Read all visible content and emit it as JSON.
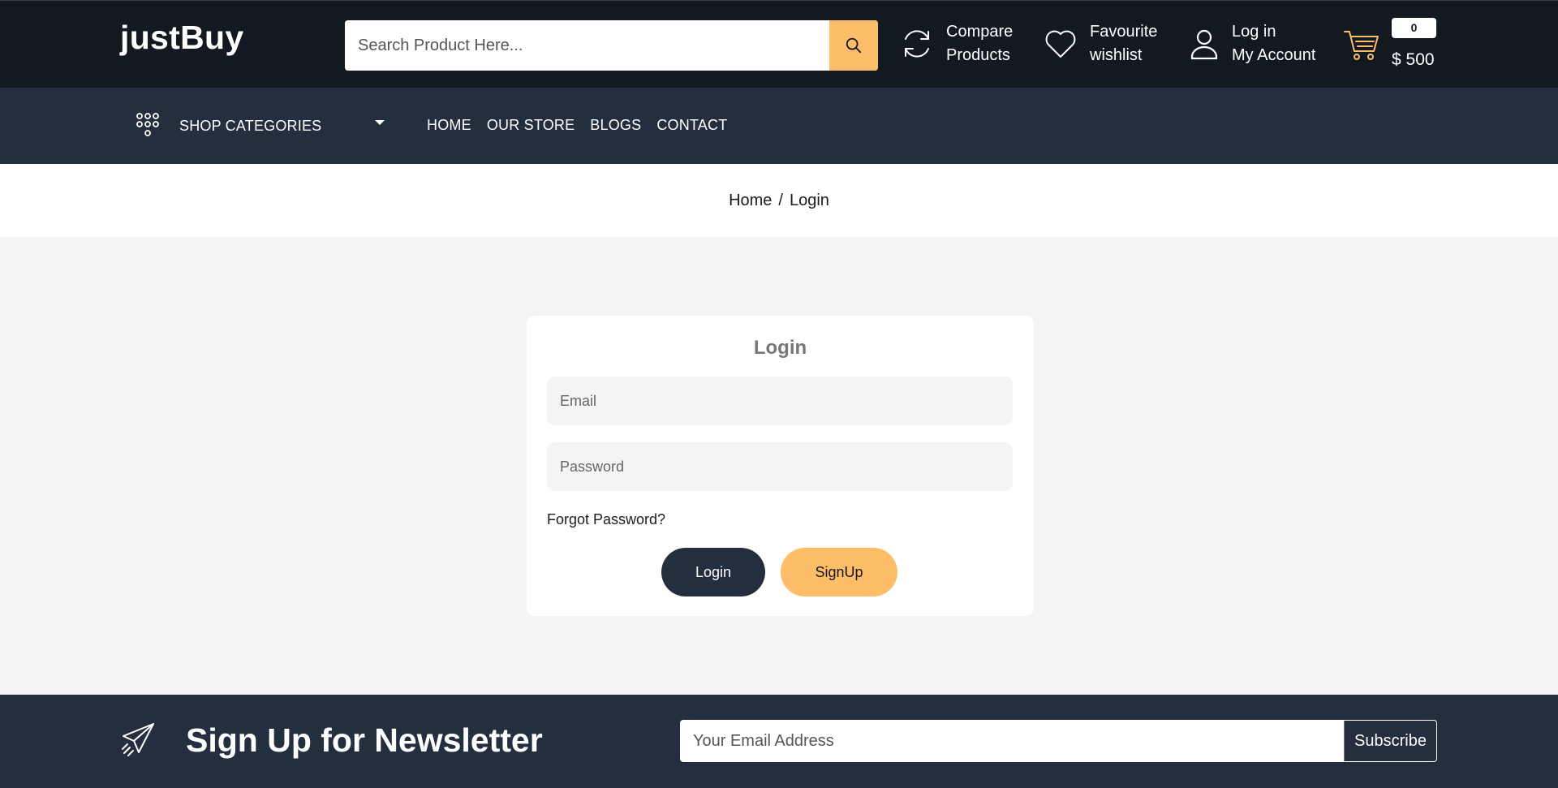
{
  "header": {
    "logo": "justBuy",
    "search": {
      "placeholder": "Search Product Here..."
    },
    "compare": {
      "line1": "Compare",
      "line2": "Products"
    },
    "wishlist": {
      "line1": "Favourite",
      "line2": "wishlist"
    },
    "account": {
      "line1": "Log in",
      "line2": "My Account"
    },
    "cart": {
      "count": "0",
      "total": "$ 500"
    }
  },
  "nav": {
    "shop_categories": "SHOP CATEGORIES",
    "menu": [
      "HOME",
      "OUR STORE",
      "BLOGS",
      "CONTACT"
    ]
  },
  "breadcrumb": {
    "home": "Home",
    "separator": "/",
    "current": "Login"
  },
  "login": {
    "title": "Login",
    "email_placeholder": "Email",
    "password_placeholder": "Password",
    "forgot": "Forgot Password?",
    "login_button": "Login",
    "signup_button": "SignUp"
  },
  "newsletter": {
    "title": "Sign Up for Newsletter",
    "placeholder": "Your Email Address",
    "button": "Subscribe"
  },
  "colors": {
    "header_bg": "#131921",
    "nav_bg": "#232f3e",
    "accent": "#febd69",
    "page_bg": "#f4f4f6"
  },
  "icons": [
    "search-icon",
    "compare-icon",
    "heart-icon",
    "user-icon",
    "cart-icon",
    "grid-icon",
    "caret-down-icon",
    "paper-plane-icon"
  ]
}
